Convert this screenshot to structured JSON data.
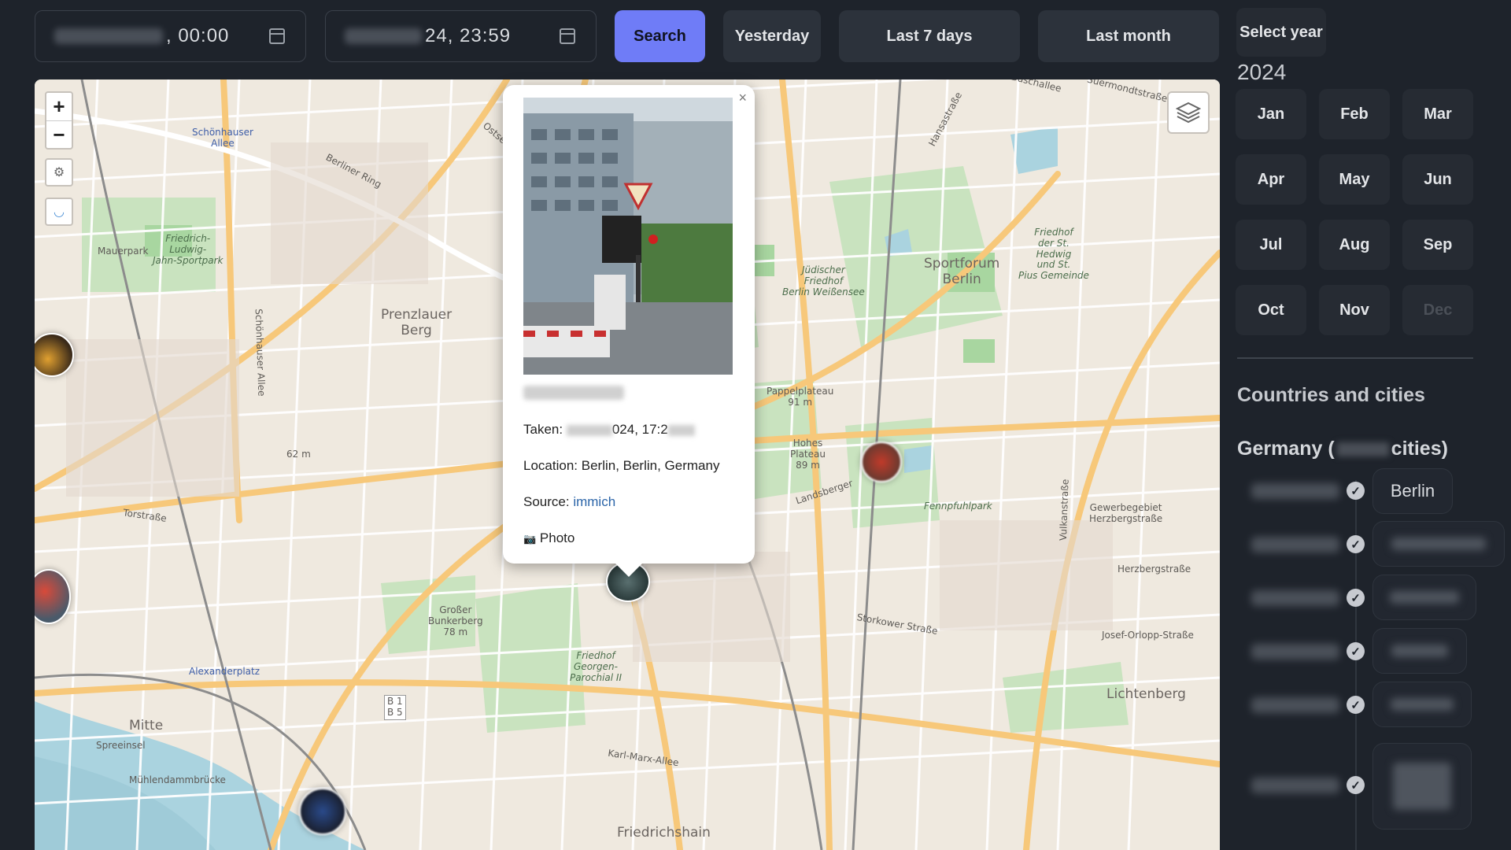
{
  "filters": {
    "start_time": ", 00:00",
    "end_time": "24, 23:59",
    "search_label": "Search",
    "yesterday_label": "Yesterday",
    "last7_label": "Last 7 days",
    "last_month_label": "Last month"
  },
  "map": {
    "zoom_in": "+",
    "zoom_out": "−",
    "labels": {
      "schoenhauser": "Schönhauser\nAllee",
      "prenzlauer": "Prenzlauer\nBerg",
      "mauerpark": "Mauerpark",
      "jahn": "Friedrich-\nLudwig-\nJahn-Sportpark",
      "sportforum": "Sportforum\nBerlin",
      "juedischer": "Jüdischer\nFriedhof\nBerlin Weißensee",
      "friedhof_hedwig": "Friedhof\nder St.\nHedwig\nund St.\nPius Gemeinde",
      "pappelplateau": "Pappelplateau\n91 m",
      "hohes_plateau": "Hohes\nPlateau\n89 m",
      "fennpfuhlpark": "Fennpfuhlpark",
      "gewerbegebiet": "Gewerbegebiet\nHerzbergstraße",
      "herzbergstrasse": "Herzbergstraße",
      "grosser_bunkerberg": "Großer\nBunkerberg\n78 m",
      "friedhof_georgen": "Friedhof\nGeorgen-\nParochial II",
      "alexanderplatz": "Alexanderplatz",
      "mitte": "Mitte",
      "spreeinsel": "Spreeinsel",
      "muehlendamm": "Mühlendammbrücke",
      "karl_marx": "Karl-Marx-Allee",
      "friedrichshain": "Friedrichshain",
      "lichtenberg": "Lichtenberg",
      "landsberger": "Landsberger",
      "storkower": "Storkower Straße",
      "josef_orlopp": "Josef-Orlopp-Straße",
      "torstrasse": "Torstraße",
      "b1b5": "B 1\nB 5",
      "m62": "62 m",
      "schlosshauser": "Schönhauser Allee",
      "vulkanstrasse": "Vulkanstraße",
      "hansastrasse": "Hansastraße",
      "suermondtstrasse": "Suermondtstraße",
      "buschallee": "Buschallee",
      "berliner_ring": "Berliner Ring",
      "ostseestr": "Ostsee"
    }
  },
  "popup": {
    "close": "×",
    "taken_label": "Taken:",
    "taken_value": "024, 17:2",
    "location_label": "Location:",
    "location_value": "Berlin, Berlin, Germany",
    "source_label": "Source:",
    "source_value": "immich",
    "type_icon": "📷",
    "type_value": "Photo"
  },
  "sidebar": {
    "select_year_label": "Select year",
    "year": "2024",
    "months": [
      "Jan",
      "Feb",
      "Mar",
      "Apr",
      "May",
      "Jun",
      "Jul",
      "Aug",
      "Sep",
      "Oct",
      "Nov",
      "Dec"
    ],
    "disabled_month": "Dec",
    "countries_heading": "Countries and cities",
    "country_name": "Germany (",
    "country_suffix": "cities)",
    "first_city": "Berlin",
    "check_glyph": "✓"
  },
  "colors": {
    "primary": "#6f7cf7",
    "background": "#1e232b",
    "button": "#2c323b"
  }
}
